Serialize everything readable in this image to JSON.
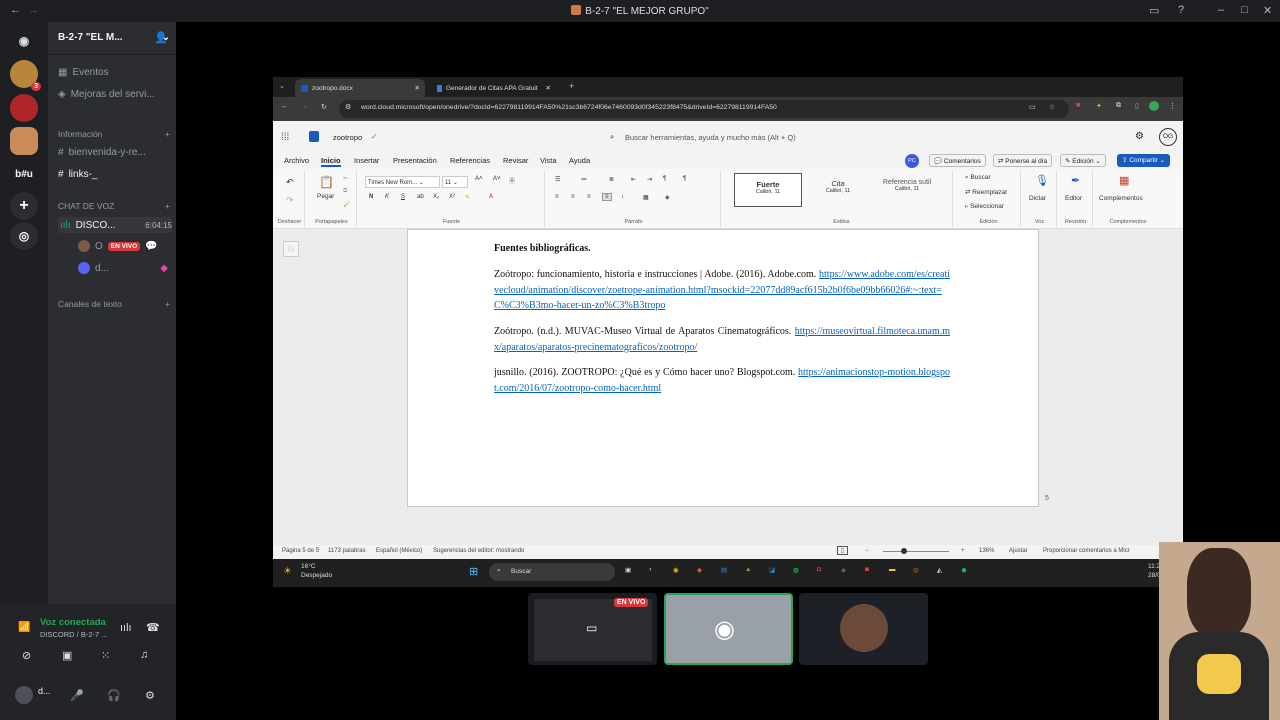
{
  "window": {
    "title": "B-2-7 \"EL MEJOR GRUPO\""
  },
  "server": {
    "name": "B-2-7 \"EL M..."
  },
  "sidebar": {
    "top_items": [
      {
        "label": "Eventos"
      },
      {
        "label": "Mejoras del servi..."
      }
    ],
    "categories": {
      "info": "Información",
      "voice": "CHAT DE VOZ",
      "text": "Canales de texto"
    },
    "text_channels": [
      {
        "label": "bienvenida-y-re..."
      },
      {
        "label": "links-_"
      }
    ],
    "voice_channel": {
      "label": "DISCO...",
      "timer": "6:04:15"
    },
    "voice_users": [
      {
        "name": "O",
        "badge": "EN VIVO"
      },
      {
        "name": "d..."
      }
    ]
  },
  "voicepanel": {
    "status": "Voz conectada",
    "channel": "DISCORD / B-2-7 ...",
    "user": "d..."
  },
  "rail": {
    "badge": "3",
    "label": "b#u"
  },
  "browser": {
    "tabs": [
      {
        "label": "zootropo.docx"
      },
      {
        "label": "Generador de Citas APA Gratuit"
      }
    ],
    "url": "word.cloud.microsoft/open/onedrive/?docId=622798119914FA50%21sc3b6724f06e7460093d0f345223f8475&driveId=622798119914FA50"
  },
  "word": {
    "doc_name": "zootropo",
    "search_placeholder": "Buscar herramientas, ayuda y mucho más (Alt + Q)",
    "avatar": "OG",
    "presence": "PC",
    "menu": [
      "Archivo",
      "Inicio",
      "Insertar",
      "Presentación",
      "Referencias",
      "Revisar",
      "Vista",
      "Ayuda"
    ],
    "right_buttons": [
      "Comentarios",
      "Ponerse al día",
      "Edición",
      "Compartir"
    ],
    "ribbon": {
      "undo_label": "Deshacer",
      "clipboard_label": "Portapapeles",
      "paste": "Pegar",
      "font_name": "Times New Rom...",
      "font_size": "11",
      "font_label": "Fuente",
      "bold": "N",
      "italic": "K",
      "underline": "S",
      "paragraph_label": "Párrafo",
      "styles": [
        {
          "name": "Fuerte",
          "sub": "Calibri, 11"
        },
        {
          "name": "Cita",
          "sub": "Calibri, 11"
        },
        {
          "name": "Referencia sutil",
          "sub": "Calibri, 11"
        }
      ],
      "styles_label": "Estilos",
      "edit": [
        "Buscar",
        "Reemplazar",
        "Seleccionar"
      ],
      "edit_label": "Edición",
      "dictate": "Dictar",
      "voice_label": "Voz",
      "editor": "Editor",
      "review_label": "Revisión",
      "addins": "Complementos",
      "addins_label": "Complementos"
    },
    "document": {
      "heading": "Fuentes bibliográficas.",
      "refs": [
        {
          "text": "Zoótropo: funcionamiento, historia e instrucciones | Adobe. (2016). Adobe.com.",
          "link": "https://www.adobe.com/es/creativecloud/animation/discover/zoetrope-animation.html?msockid=22077dd89acf615b2b0f6be09bb66026#:~:text=C%C3%B3mo-hacer-un-zo%C3%B3tropo"
        },
        {
          "text": "Zoótropo. (n.d.). MUVAC-Museo Virtual de Aparatos Cinematográficos.",
          "link": "https://museovirtual.filmoteca.unam.mx/aparatos/aparatos-precinematograficos/zootropo/"
        },
        {
          "text": "jusnillo. (2016). ZOOTROPO: ¿Qué es y Cómo hacer uno? Blogspot.com.",
          "link": "https://animacionstop-motion.blogspot.com/2016/07/zootropo-como-hacer.html"
        }
      ],
      "page_number": "5"
    },
    "status": {
      "page": "Página 5 de 5",
      "words": "1173 palabras",
      "lang": "Español (México)",
      "editor": "Sugerencias del editor: mostrando",
      "zoom": "136%",
      "fit": "Ajustar",
      "feedback": "Proporcionar comentarios a Micr"
    }
  },
  "taskbar": {
    "weather_temp": "16°C",
    "weather_desc": "Despejado",
    "search": "Buscar",
    "time": "11:27 p",
    "date": "28/02/2"
  },
  "stream_tiles": {
    "live_badge": "EN VIVO"
  },
  "colors": {
    "discord_bg": "#1e1f22",
    "sidebar": "#2b2d31",
    "live": "#da373c",
    "accent": "#5865f2",
    "green": "#23a55a",
    "word_blue": "#185abd"
  }
}
